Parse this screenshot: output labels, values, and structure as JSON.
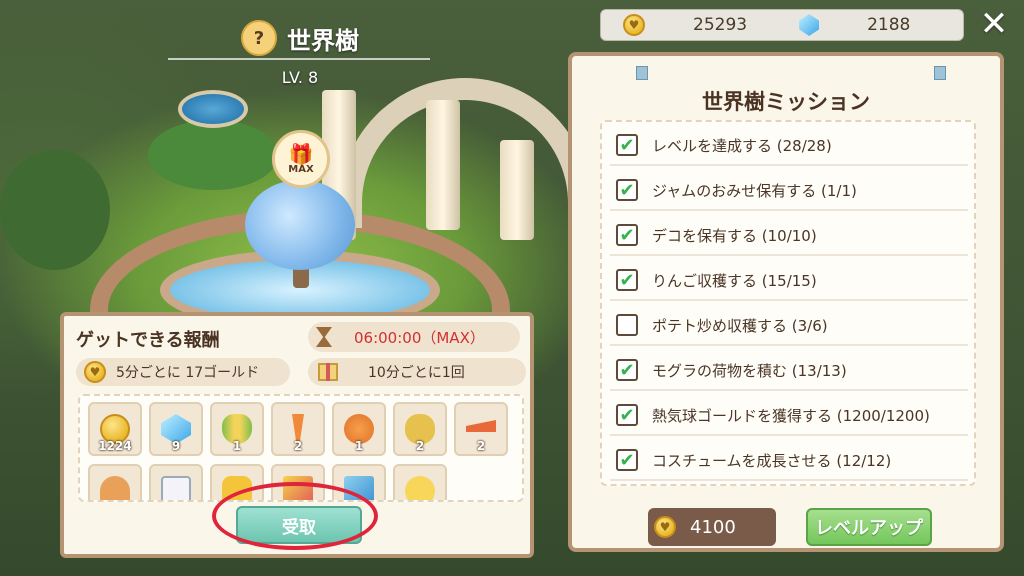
{
  "header": {
    "title": "世界樹",
    "level": "LV. 8",
    "gift_badge": "MAX"
  },
  "currency": {
    "coins": "25293",
    "gems": "2188"
  },
  "mission": {
    "title": "世界樹ミッション",
    "items": [
      {
        "label": "レベルを達成する (28/28)",
        "checked": true
      },
      {
        "label": "ジャムのおみせ保有する (1/1)",
        "checked": true
      },
      {
        "label": "デコを保有する (10/10)",
        "checked": true
      },
      {
        "label": "りんご収穫する (15/15)",
        "checked": true
      },
      {
        "label": "ポテト炒め収穫する (3/6)",
        "checked": false
      },
      {
        "label": "モグラの荷物を積む (13/13)",
        "checked": true
      },
      {
        "label": "熱気球ゴールドを獲得する (1200/1200)",
        "checked": true
      },
      {
        "label": "コスチュームを成長させる (12/12)",
        "checked": true
      }
    ],
    "cost": "4100",
    "level_up_label": "レベルアップ"
  },
  "reward": {
    "title": "ゲットできる報酬",
    "timer": "06:00:00（MAX）",
    "gold_rate": "5分ごとに 17ゴールド",
    "gift_rate": "10分ごとに1回",
    "items": [
      {
        "icon": "gold-coin-icon",
        "count": "1224"
      },
      {
        "icon": "blue-gem-icon",
        "count": "9"
      },
      {
        "icon": "corn-icon",
        "count": "1"
      },
      {
        "icon": "carrot-icon",
        "count": "2"
      },
      {
        "icon": "pumpkin-icon",
        "count": "1"
      },
      {
        "icon": "potato-icon",
        "count": "2"
      },
      {
        "icon": "red-carrot-icon",
        "count": "2"
      },
      {
        "icon": "pie-icon",
        "count": ""
      },
      {
        "icon": "milk-icon",
        "count": ""
      },
      {
        "icon": "honeycomb-icon",
        "count": ""
      },
      {
        "icon": "card-icon",
        "count": ""
      },
      {
        "icon": "photo-icon",
        "count": ""
      },
      {
        "icon": "chick-icon",
        "count": ""
      }
    ],
    "receive_label": "受取"
  },
  "colors": {
    "accent_red": "#e0243a",
    "timer_red": "#d03030",
    "check_green": "#34b34a"
  }
}
